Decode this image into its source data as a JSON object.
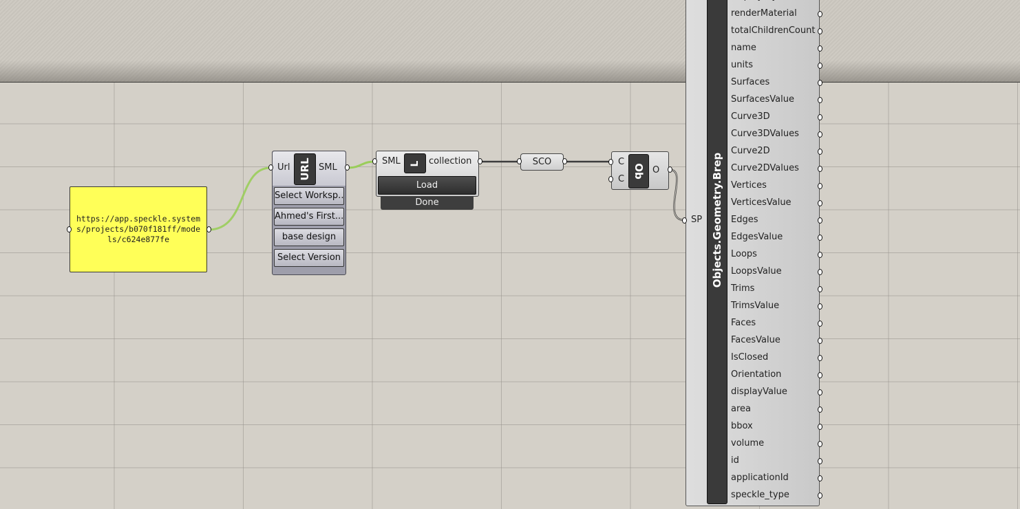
{
  "panel": {
    "text": "https://app.speckle.systems/projects/b070f181ff/models/c624e877fe",
    "color": "#ffff58"
  },
  "url_component": {
    "input_label": "Url",
    "icon_text": "URL",
    "output_label": "SML",
    "buttons": [
      "Select Worksp...",
      "Ahmed's First...",
      "base design",
      "Select Version"
    ]
  },
  "load_component": {
    "input_label": "SML",
    "icon_text": "L",
    "output_label": "collection",
    "button_label": "Load",
    "status_text": "Done"
  },
  "sco_param": {
    "label": "SCO"
  },
  "ob_component": {
    "inputs": [
      "C",
      "C"
    ],
    "icon_text": "Ob",
    "output_label": "O"
  },
  "deconstruct_component": {
    "title": "Objects.Geometry.Brep",
    "input_label": "SP",
    "outputs": [
      "displayStyle",
      "renderMaterial",
      "totalChildrenCount",
      "name",
      "units",
      "Surfaces",
      "SurfacesValue",
      "Curve3D",
      "Curve3DValues",
      "Curve2D",
      "Curve2DValues",
      "Vertices",
      "VerticesValue",
      "Edges",
      "EdgesValue",
      "Loops",
      "LoopsValue",
      "Trims",
      "TrimsValue",
      "Faces",
      "FacesValue",
      "IsClosed",
      "Orientation",
      "displayValue",
      "area",
      "bbox",
      "volume",
      "id",
      "applicationId",
      "speckle_type"
    ]
  },
  "colors": {
    "canvas": "#d4d0c8",
    "wire_selected": "#9acd5a",
    "wire_default": "#3c3c3c"
  }
}
